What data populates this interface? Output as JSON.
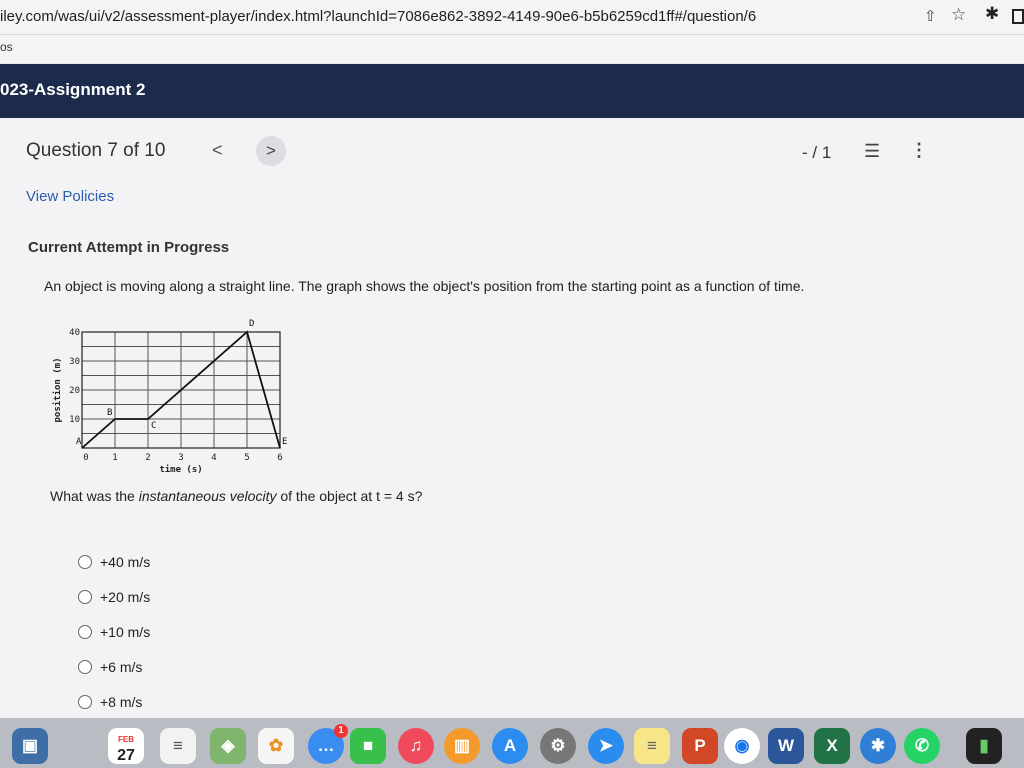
{
  "browser": {
    "url": "iley.com/was/ui/v2/assessment-player/index.html?launchId=7086e862-3892-4149-90e6-b5b6259cd1ff#/question/6",
    "bookmark": "os"
  },
  "course": {
    "title": "023-Assignment 2"
  },
  "question_header": {
    "title": "Question 7 of 10",
    "prev_glyph": "<",
    "next_glyph": ">",
    "score": "- / 1"
  },
  "policies_link": "View Policies",
  "attempt_status": "Current Attempt in Progress",
  "prompt": "An object is moving along a straight line. The graph shows the object's position from the starting point as a function of time.",
  "question": {
    "before": "What was the ",
    "emphasis": "instantaneous velocity",
    "after": " of the object at t = 4 s?"
  },
  "choices": [
    "+40 m/s",
    "+20 m/s",
    "+10 m/s",
    "+6 m/s",
    "+8 m/s"
  ],
  "chart_data": {
    "type": "line",
    "xlabel": "time (s)",
    "ylabel": "position (m)",
    "xlim": [
      0,
      6
    ],
    "ylim": [
      0,
      40
    ],
    "x_ticks": [
      "0",
      "1",
      "2",
      "3",
      "4",
      "5",
      "6"
    ],
    "y_ticks": [
      "10",
      "20",
      "30",
      "40"
    ],
    "grid": true,
    "series": [
      {
        "x": [
          0,
          1,
          2,
          5,
          6
        ],
        "y": [
          0,
          10,
          10,
          40,
          0
        ]
      }
    ],
    "point_labels": [
      {
        "label": "A",
        "x": 0,
        "y": 0
      },
      {
        "label": "B",
        "x": 1,
        "y": 10
      },
      {
        "label": "C",
        "x": 2,
        "y": 10
      },
      {
        "label": "D",
        "x": 5,
        "y": 40
      },
      {
        "label": "E",
        "x": 6,
        "y": 0
      }
    ]
  },
  "dock": {
    "calendar_month": "FEB",
    "calendar_day": "27",
    "badge_count": "1",
    "apps": [
      "preview-app",
      "calendar-app",
      "notes-app",
      "maps-app",
      "photos-app",
      "messages-app",
      "facetime-app",
      "music-app",
      "books-app",
      "appstore-app",
      "settings-app",
      "safari-app",
      "notes2-app",
      "powerpoint-app",
      "chrome-app",
      "word-app",
      "excel-app",
      "bluetooth-app",
      "whatsapp-app",
      "terminal-app"
    ]
  }
}
